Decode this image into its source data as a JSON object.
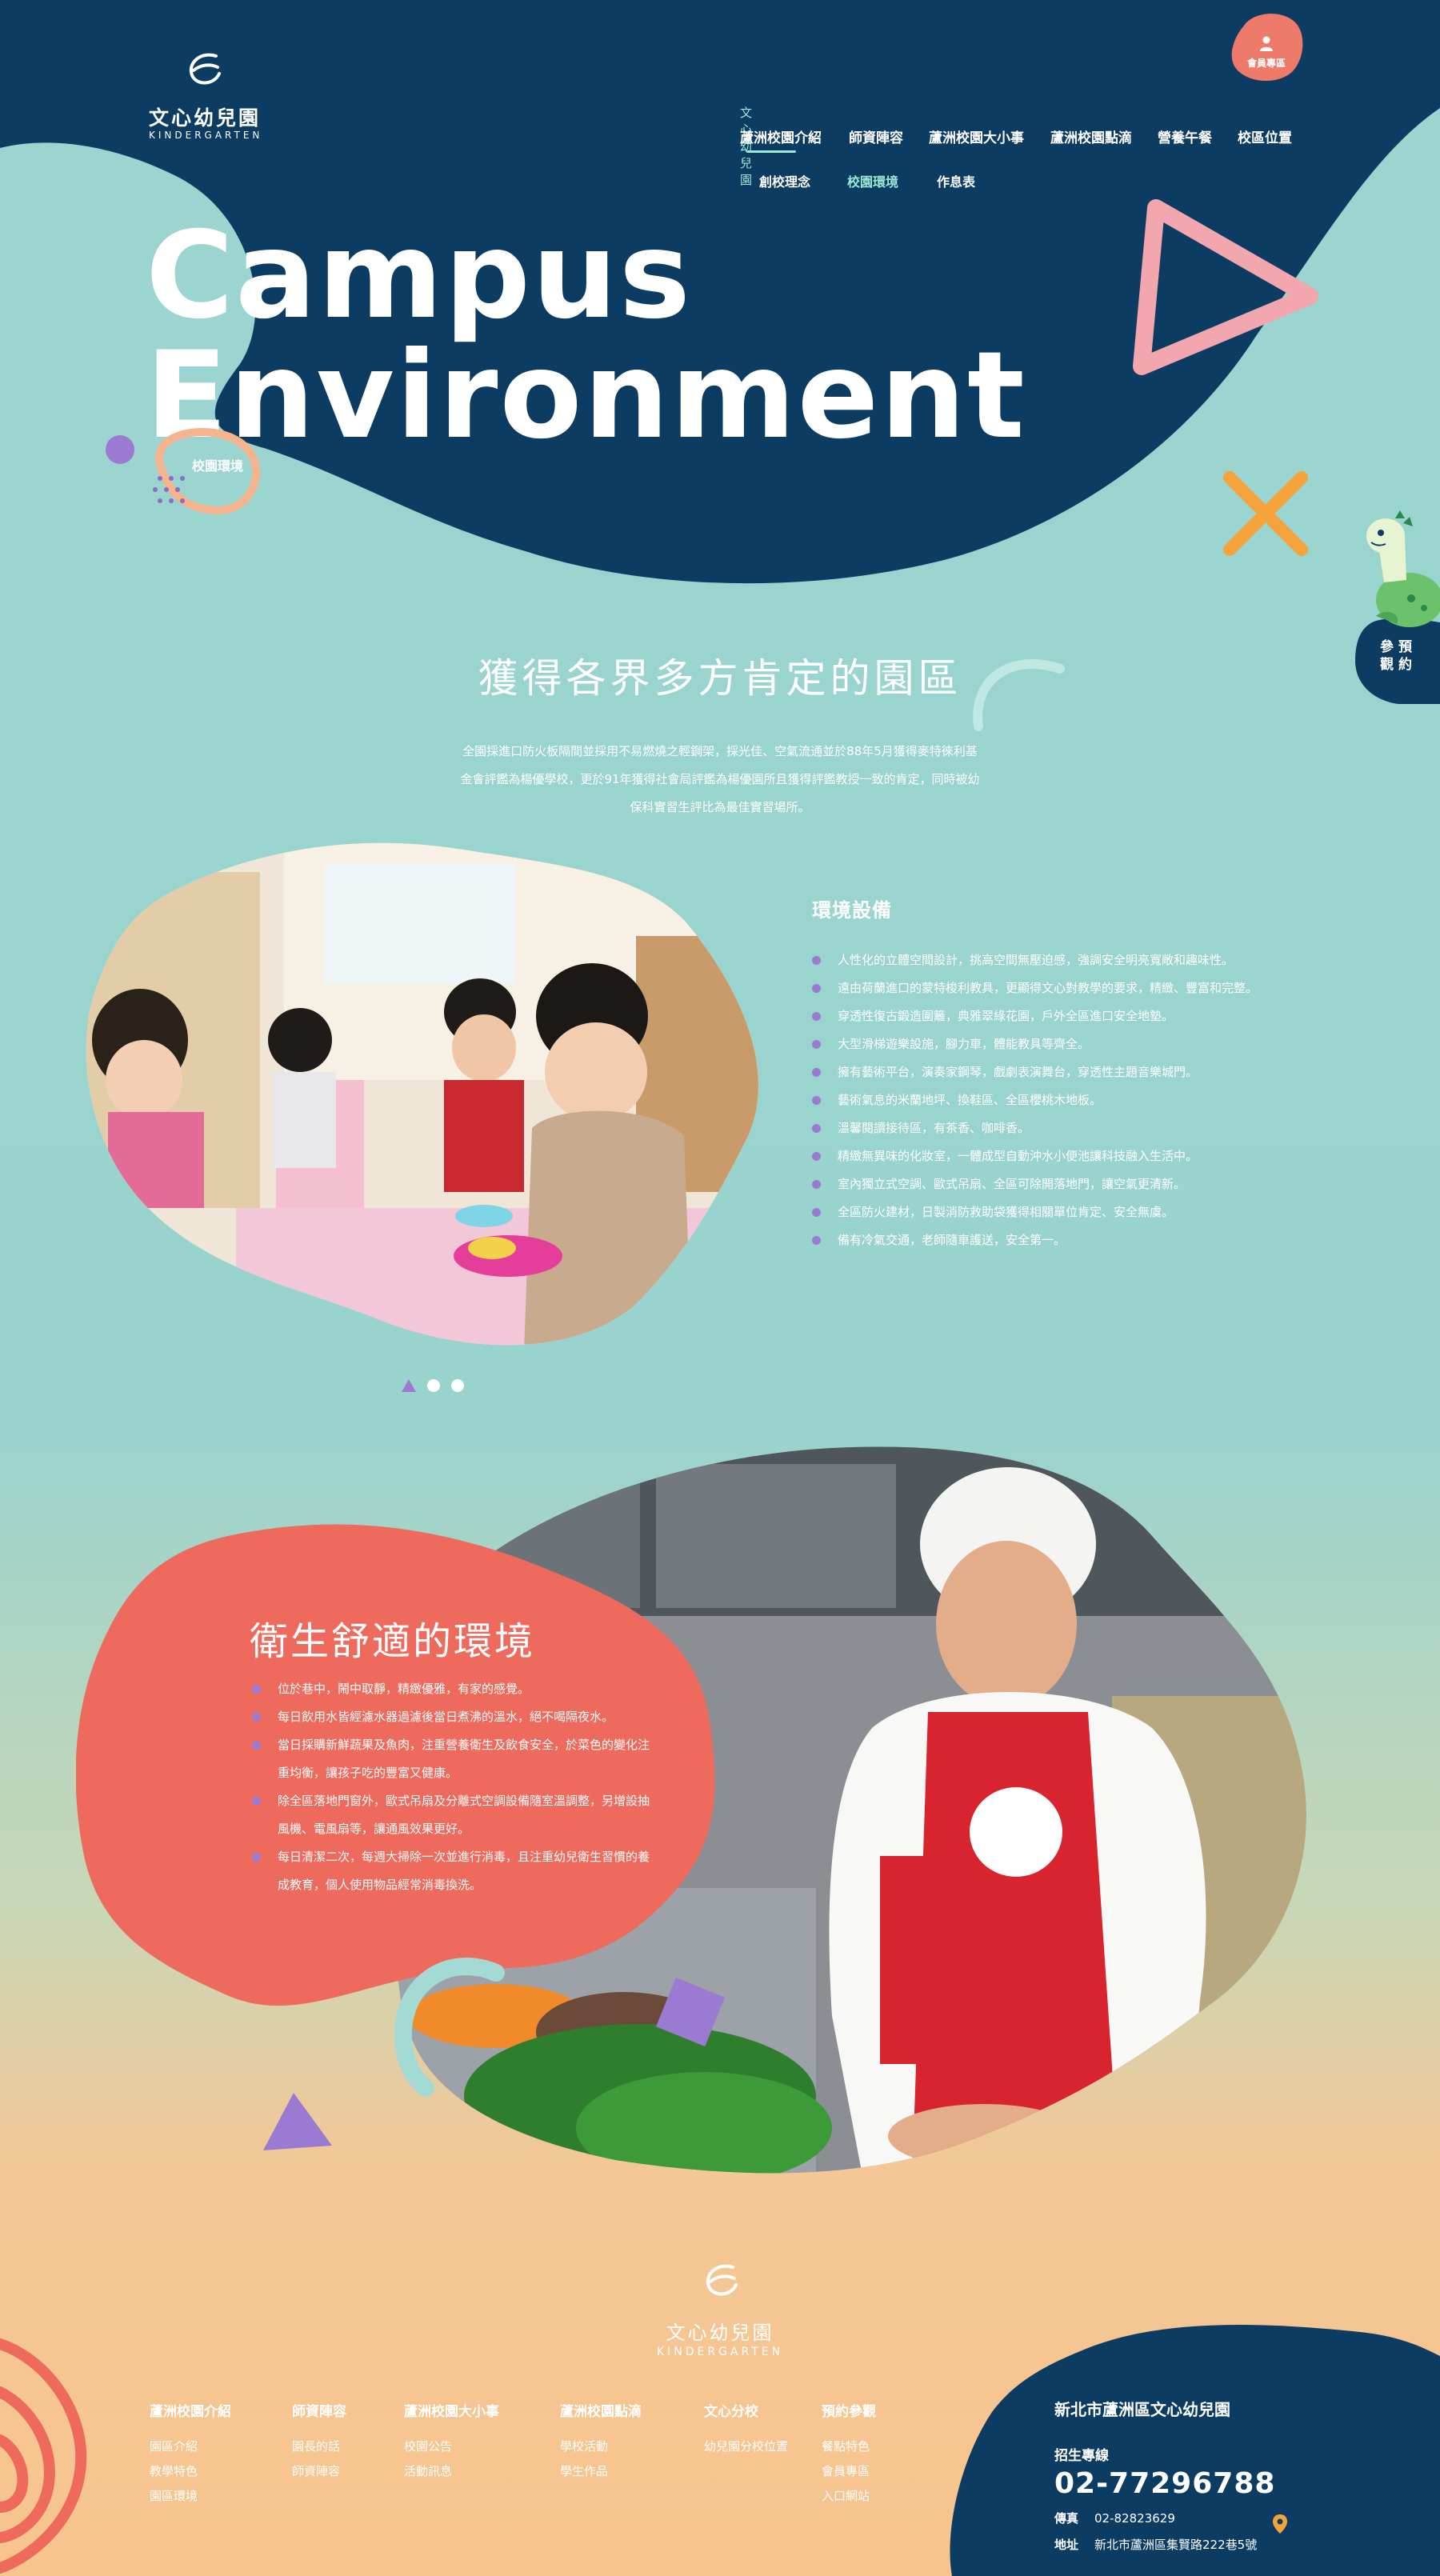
{
  "brand": {
    "name_cn": "文心幼兒園",
    "name_en": "KINDERGARTEN"
  },
  "nav": {
    "section_label": "文心幼兒園",
    "items": [
      {
        "label": "蘆洲校園介紹"
      },
      {
        "label": "師資陣容"
      },
      {
        "label": "蘆洲校園大小事"
      },
      {
        "label": "蘆洲校園點滴"
      },
      {
        "label": "營養午餐"
      },
      {
        "label": "校區位置"
      }
    ],
    "sub_items": [
      {
        "label": "創校理念"
      },
      {
        "label": "校園環境"
      },
      {
        "label": "作息表"
      }
    ]
  },
  "member_button": {
    "label": "會員專區",
    "icon": "user-icon"
  },
  "booking_button": {
    "line1": "參 預",
    "line2": "觀 約"
  },
  "hero": {
    "title_line1": "Campus",
    "title_line2": "Environment",
    "subtitle": "校園環境"
  },
  "section_recognition": {
    "title": "獲得各界多方肯定的園區",
    "description": "全園採進口防火板隔間並採用不易燃燒之輕鋼架，採光佳、空氣流通並於88年5月獲得麥特徠利基金會評鑑為楊優學校，更於91年獲得社會局評鑑為楊優園所且獲得評鑑教授一致的肯定，同時被幼保科實習生評比為最佳實習場所。"
  },
  "section_facilities": {
    "title": "環境設備",
    "items": [
      "人性化的立體空間設計，挑高空間無壓迫感，強調安全明亮寬敞和趣味性。",
      "遠由荷蘭進口的蒙特梭利教具，更顯得文心對教學的要求，精緻、豐富和完整。",
      "穿透性復古鍛造圍籬，典雅翠綠花園，戶外全區進口安全地墊。",
      "大型滑梯遊樂設施，腳力車，體能教具等齊全。",
      "擁有藝術平台，演奏家鋼琴，戲劇表演舞台，穿透性主題音樂城門。",
      "藝術氣息的米蘭地坪、換鞋區、全區櫻桃木地板。",
      "溫馨閱讀接待區，有茶香、咖啡香。",
      "精緻無異味的化妝室，一體成型自動沖水小便池讓科技融入生活中。",
      "室內獨立式空調、歐式吊扇、全區可除開落地門，讓空氣更清新。",
      "全區防火建材，日製消防救助袋獲得相關單位肯定、安全無虞。",
      "備有冷氣交通，老師隨車護送，安全第一。"
    ],
    "carousel_total": 3,
    "carousel_active": 1
  },
  "section_hygiene": {
    "title": "衛生舒適的環境",
    "items": [
      "位於巷中，鬧中取靜，精緻優雅，有家的感覺。",
      "每日飲用水皆經濾水器過濾後當日煮沸的溫水，絕不喝隔夜水。",
      "當日採購新鮮蔬果及魚肉，注重營養衛生及飲食安全，於菜色的變化注重均衡，讓孩子吃的豐富又健康。",
      "除全區落地門窗外，歐式吊扇及分離式空調設備隨室溫調整，另增設抽風機、電風扇等，讓通風效果更好。",
      "每日清潔二次，每週大掃除一次並進行消毒，且注重幼兒衛生習慣的養成教育，個人使用物品經常消毒換洗。"
    ]
  },
  "footer": {
    "columns": [
      {
        "heading": "蘆洲校園介紹",
        "links": [
          "園區介紹",
          "教學特色",
          "園區環境"
        ]
      },
      {
        "heading": "師資陣容",
        "links": [
          "園長的話",
          "師資陣容"
        ]
      },
      {
        "heading": "蘆洲校園大小事",
        "links": [
          "校園公告",
          "活動訊息"
        ]
      },
      {
        "heading": "蘆洲校園點滴",
        "links": [
          "學校活動",
          "學生作品"
        ]
      },
      {
        "heading": "文心分校",
        "links": [
          "幼兒園分校位置"
        ]
      },
      {
        "heading": "預約參觀",
        "links": [
          "餐點特色",
          "會員專區",
          "入口網站"
        ]
      }
    ],
    "contact": {
      "name": "新北市蘆洲區文心幼兒園",
      "hotline_label": "招生專線",
      "hotline": "02-77296788",
      "fax_label": "傳真",
      "fax": "02-82823629",
      "address_label": "地址",
      "address": "新北市蘆洲區集賢路222巷5號"
    }
  },
  "colors": {
    "navy": "#0d3c63",
    "teal": "#9cd5d0",
    "coral": "#ee6a5c",
    "pink": "#f2a6ad",
    "purple": "#9b7bd1",
    "orange": "#f5a33a",
    "mint": "#9ce8d7"
  }
}
